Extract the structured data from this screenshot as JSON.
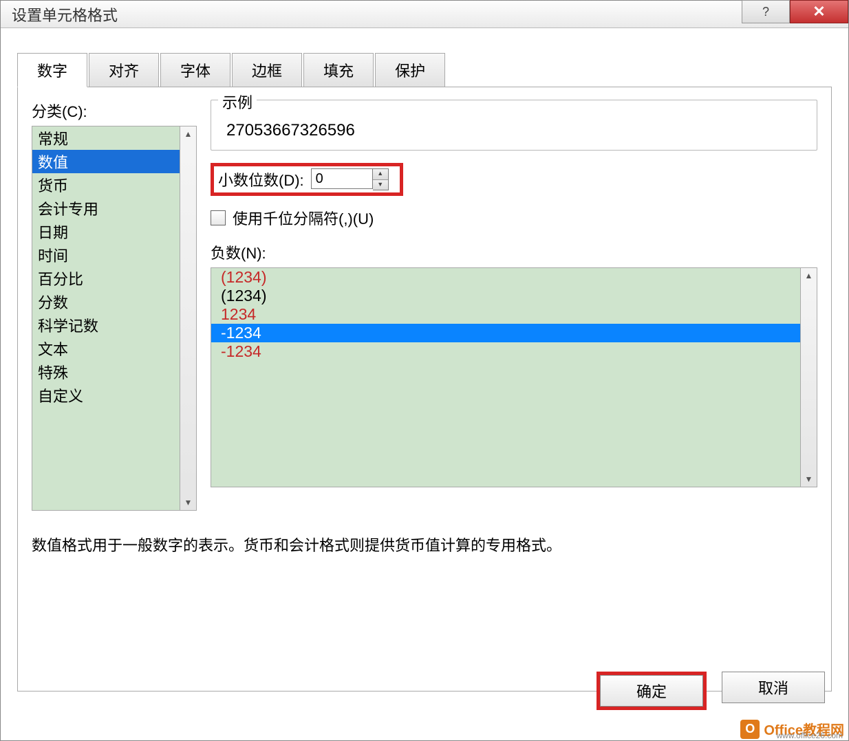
{
  "window": {
    "title": "设置单元格格式"
  },
  "tabs": [
    {
      "label": "数字",
      "active": true
    },
    {
      "label": "对齐"
    },
    {
      "label": "字体"
    },
    {
      "label": "边框"
    },
    {
      "label": "填充"
    },
    {
      "label": "保护"
    }
  ],
  "category": {
    "label": "分类(C):",
    "items": [
      "常规",
      "数值",
      "货币",
      "会计专用",
      "日期",
      "时间",
      "百分比",
      "分数",
      "科学记数",
      "文本",
      "特殊",
      "自定义"
    ],
    "selected_index": 1
  },
  "example": {
    "legend": "示例",
    "value": "27053667326596"
  },
  "decimal": {
    "label": "小数位数(D):",
    "value": "0"
  },
  "thousands": {
    "label": "使用千位分隔符(,)(U)",
    "checked": false
  },
  "negative": {
    "label": "负数(N):",
    "items": [
      {
        "text": "(1234)",
        "color": "red"
      },
      {
        "text": "(1234)",
        "color": "black"
      },
      {
        "text": "1234",
        "color": "red"
      },
      {
        "text": "-1234",
        "color": "black",
        "selected": true
      },
      {
        "text": "-1234",
        "color": "red"
      }
    ]
  },
  "description": "数值格式用于一般数字的表示。货币和会计格式则提供货币值计算的专用格式。",
  "buttons": {
    "ok": "确定",
    "cancel": "取消"
  },
  "watermark": {
    "text": "Office教程网",
    "sub": "www.office26.com"
  }
}
